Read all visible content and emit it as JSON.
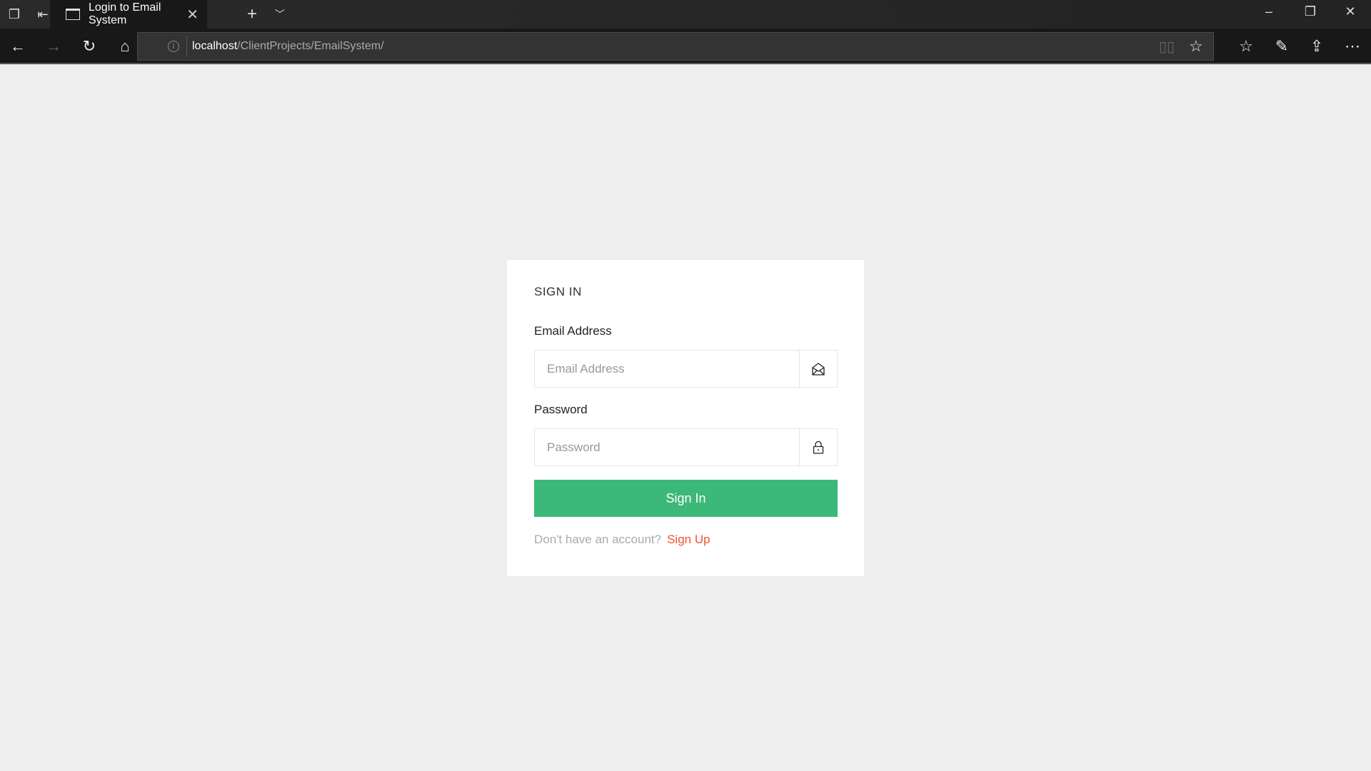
{
  "browser": {
    "tab_title": "Login to Email System",
    "url_host": "localhost",
    "url_path": "/ClientProjects/EmailSystem/"
  },
  "form": {
    "title": "SIGN IN",
    "email_label": "Email Address",
    "email_placeholder": "Email Address",
    "email_value": "",
    "password_label": "Password",
    "password_placeholder": "Password",
    "password_value": "",
    "submit_label": "Sign In",
    "footer_text": "Don't have an account?",
    "signup_link": "Sign Up"
  },
  "colors": {
    "accent": "#3cb878",
    "link": "#f2522e",
    "background": "#eeeeee"
  }
}
